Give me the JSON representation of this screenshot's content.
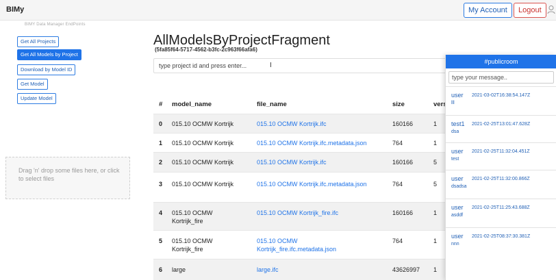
{
  "app": {
    "brand": "BIMy"
  },
  "header": {
    "account_label": "My Account",
    "logout_label": "Logout"
  },
  "sidebar": {
    "title": "BIMY Data Manager EndPoints",
    "buttons": [
      {
        "label": "Get All Projects",
        "active": false
      },
      {
        "label": "Get All Models by Project",
        "active": true
      },
      {
        "label": "Download by Model ID",
        "active": false
      },
      {
        "label": "Get Model",
        "active": false
      },
      {
        "label": "Update Model",
        "active": false
      }
    ],
    "dropzone_text": "Drag 'n' drop some files here, or click to select files"
  },
  "main": {
    "title": "AllModelsByProjectFragment",
    "subtitle": "(5fa85f64-5717-4562-b3fc-2c963f66afa6)",
    "input_placeholder": "type project id and press enter...",
    "table": {
      "headers": [
        "#",
        "model_name",
        "file_name",
        "size",
        "vers"
      ],
      "rows": [
        {
          "idx": "0",
          "model_name": "015.10 OCMW Kortrijk",
          "file_name": "015.10 OCMW Kortrijk.ifc",
          "size": "160166",
          "version": "1"
        },
        {
          "idx": "1",
          "model_name": "015.10 OCMW Kortrijk",
          "file_name": "015.10 OCMW Kortrijk.ifc.metadata.json",
          "size": "764",
          "version": "1"
        },
        {
          "idx": "2",
          "model_name": "015.10 OCMW Kortrijk",
          "file_name": "015.10 OCMW Kortrijk.ifc",
          "size": "160166",
          "version": "5"
        },
        {
          "idx": "3",
          "model_name": "015.10 OCMW Kortrijk",
          "file_name": "015.10 OCMW Kortrijk.ifc.metadata.json",
          "size": "764",
          "version": "5"
        },
        {
          "idx": "4",
          "model_name": "015.10 OCMW Kortrijk_fire",
          "file_name": "015.10 OCMW Kortrijk_fire.ifc",
          "size": "160166",
          "version": "1"
        },
        {
          "idx": "5",
          "model_name": "015.10 OCMW Kortrijk_fire",
          "file_name": "015.10 OCMW Kortrijk_fire.ifc.metadata.json",
          "size": "764",
          "version": "1"
        },
        {
          "idx": "6",
          "model_name": "large",
          "file_name": "large.ifc",
          "size": "43626997",
          "version": "1"
        }
      ]
    }
  },
  "chat": {
    "room": "#publicroom",
    "input_placeholder": "type your message..",
    "messages": [
      {
        "user": "user",
        "time": "2021-03-02T16:38:54.147Z",
        "text": "lll"
      },
      {
        "user": "test1",
        "time": "2021-02-25T13:01:47.628Z",
        "text": "dsa"
      },
      {
        "user": "user",
        "time": "2021-02-25T11:32:04.451Z",
        "text": "test"
      },
      {
        "user": "user",
        "time": "2021-02-25T11:32:00.866Z",
        "text": "dsadsa"
      },
      {
        "user": "user",
        "time": "2021-02-25T11:25:43.688Z",
        "text": "asddf"
      },
      {
        "user": "user",
        "time": "2021-02-25T08:37:30.381Z",
        "text": "nnn"
      }
    ]
  },
  "colors": {
    "primary": "#1f73e8",
    "danger": "#d9534f",
    "row_stripe": "#f1f1f1"
  }
}
